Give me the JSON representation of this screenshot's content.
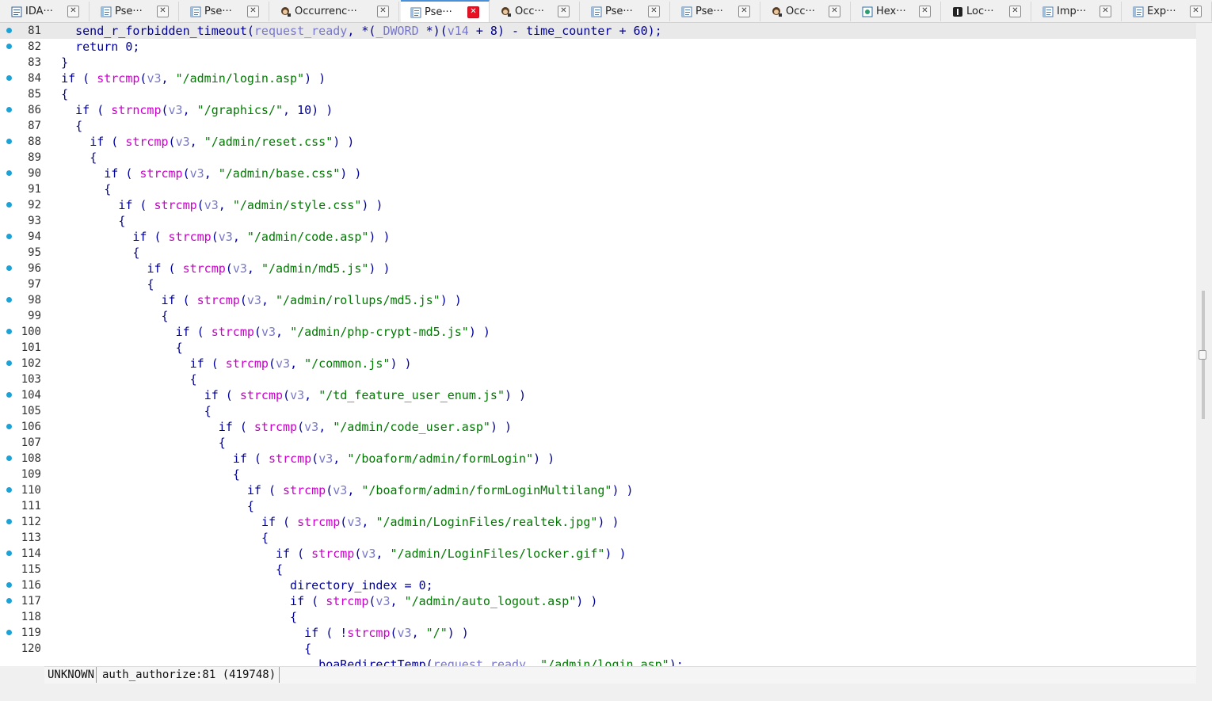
{
  "tabs": [
    {
      "label": "IDA···",
      "icon": "ida-view-icon"
    },
    {
      "label": "Pse···",
      "icon": "pseudocode-icon"
    },
    {
      "label": "Pse···",
      "icon": "pseudocode-icon"
    },
    {
      "label": "Occurrenc···",
      "icon": "occurrences-icon"
    },
    {
      "label": "Pse···",
      "icon": "pseudocode-icon",
      "active": true
    },
    {
      "label": "Occ···",
      "icon": "occurrences-icon"
    },
    {
      "label": "Pse···",
      "icon": "pseudocode-icon"
    },
    {
      "label": "Pse···",
      "icon": "pseudocode-icon"
    },
    {
      "label": "Occ···",
      "icon": "occurrences-icon"
    },
    {
      "label": "Hex···",
      "icon": "hex-view-icon"
    },
    {
      "label": "Loc···",
      "icon": "local-types-icon"
    },
    {
      "label": "Imp···",
      "icon": "imports-icon"
    },
    {
      "label": "Exp···",
      "icon": "exports-icon"
    }
  ],
  "close_glyph": "✕",
  "code_lines": [
    {
      "n": "81",
      "bp": true,
      "current": true,
      "indent": "    ",
      "tokens": [
        [
          "fn2",
          "send_r_forbidden_timeout"
        ],
        [
          "p",
          "("
        ],
        [
          "v",
          "request_ready"
        ],
        [
          "p",
          ", *("
        ],
        [
          "v",
          "_DWORD"
        ],
        [
          "p",
          " *)("
        ],
        [
          "v",
          "v14"
        ],
        [
          "p",
          " + 8) - "
        ],
        [
          "g",
          "time_counter"
        ],
        [
          "p",
          " + 60);"
        ]
      ]
    },
    {
      "n": "82",
      "bp": true,
      "indent": "    ",
      "tokens": [
        [
          "p",
          "return 0;"
        ]
      ]
    },
    {
      "n": "83",
      "bp": false,
      "indent": "  ",
      "tokens": [
        [
          "p",
          "}"
        ]
      ]
    },
    {
      "n": "84",
      "bp": true,
      "indent": "  ",
      "tokens": [
        [
          "p",
          "if ( "
        ],
        [
          "fn",
          "strcmp"
        ],
        [
          "p",
          "("
        ],
        [
          "v",
          "v3"
        ],
        [
          "p",
          ", "
        ],
        [
          "s",
          "\"/admin/login.asp\""
        ],
        [
          "p",
          ") )"
        ]
      ]
    },
    {
      "n": "85",
      "bp": false,
      "indent": "  ",
      "tokens": [
        [
          "p",
          "{"
        ]
      ]
    },
    {
      "n": "86",
      "bp": true,
      "indent": "    ",
      "tokens": [
        [
          "p",
          "if ( "
        ],
        [
          "fn",
          "strncmp"
        ],
        [
          "p",
          "("
        ],
        [
          "v",
          "v3"
        ],
        [
          "p",
          ", "
        ],
        [
          "s",
          "\"/graphics/\""
        ],
        [
          "p",
          ", 10) )"
        ]
      ]
    },
    {
      "n": "87",
      "bp": false,
      "indent": "    ",
      "tokens": [
        [
          "p",
          "{"
        ]
      ]
    },
    {
      "n": "88",
      "bp": true,
      "indent": "      ",
      "tokens": [
        [
          "p",
          "if ( "
        ],
        [
          "fn",
          "strcmp"
        ],
        [
          "p",
          "("
        ],
        [
          "v",
          "v3"
        ],
        [
          "p",
          ", "
        ],
        [
          "s",
          "\"/admin/reset.css\""
        ],
        [
          "p",
          ") )"
        ]
      ]
    },
    {
      "n": "89",
      "bp": false,
      "indent": "      ",
      "tokens": [
        [
          "p",
          "{"
        ]
      ]
    },
    {
      "n": "90",
      "bp": true,
      "indent": "        ",
      "tokens": [
        [
          "p",
          "if ( "
        ],
        [
          "fn",
          "strcmp"
        ],
        [
          "p",
          "("
        ],
        [
          "v",
          "v3"
        ],
        [
          "p",
          ", "
        ],
        [
          "s",
          "\"/admin/base.css\""
        ],
        [
          "p",
          ") )"
        ]
      ]
    },
    {
      "n": "91",
      "bp": false,
      "indent": "        ",
      "tokens": [
        [
          "p",
          "{"
        ]
      ]
    },
    {
      "n": "92",
      "bp": true,
      "indent": "          ",
      "tokens": [
        [
          "p",
          "if ( "
        ],
        [
          "fn",
          "strcmp"
        ],
        [
          "p",
          "("
        ],
        [
          "v",
          "v3"
        ],
        [
          "p",
          ", "
        ],
        [
          "s",
          "\"/admin/style.css\""
        ],
        [
          "p",
          ") )"
        ]
      ]
    },
    {
      "n": "93",
      "bp": false,
      "indent": "          ",
      "tokens": [
        [
          "p",
          "{"
        ]
      ]
    },
    {
      "n": "94",
      "bp": true,
      "indent": "            ",
      "tokens": [
        [
          "p",
          "if ( "
        ],
        [
          "fn",
          "strcmp"
        ],
        [
          "p",
          "("
        ],
        [
          "v",
          "v3"
        ],
        [
          "p",
          ", "
        ],
        [
          "s",
          "\"/admin/code.asp\""
        ],
        [
          "p",
          ") )"
        ]
      ]
    },
    {
      "n": "95",
      "bp": false,
      "indent": "            ",
      "tokens": [
        [
          "p",
          "{"
        ]
      ]
    },
    {
      "n": "96",
      "bp": true,
      "indent": "              ",
      "tokens": [
        [
          "p",
          "if ( "
        ],
        [
          "fn",
          "strcmp"
        ],
        [
          "p",
          "("
        ],
        [
          "v",
          "v3"
        ],
        [
          "p",
          ", "
        ],
        [
          "s",
          "\"/admin/md5.js\""
        ],
        [
          "p",
          ") )"
        ]
      ]
    },
    {
      "n": "97",
      "bp": false,
      "indent": "              ",
      "tokens": [
        [
          "p",
          "{"
        ]
      ]
    },
    {
      "n": "98",
      "bp": true,
      "indent": "                ",
      "tokens": [
        [
          "p",
          "if ( "
        ],
        [
          "fn",
          "strcmp"
        ],
        [
          "p",
          "("
        ],
        [
          "v",
          "v3"
        ],
        [
          "p",
          ", "
        ],
        [
          "s",
          "\"/admin/rollups/md5.js\""
        ],
        [
          "p",
          ") )"
        ]
      ]
    },
    {
      "n": "99",
      "bp": false,
      "indent": "                ",
      "tokens": [
        [
          "p",
          "{"
        ]
      ]
    },
    {
      "n": "100",
      "bp": true,
      "indent": "                  ",
      "tokens": [
        [
          "p",
          "if ( "
        ],
        [
          "fn",
          "strcmp"
        ],
        [
          "p",
          "("
        ],
        [
          "v",
          "v3"
        ],
        [
          "p",
          ", "
        ],
        [
          "s",
          "\"/admin/php-crypt-md5.js\""
        ],
        [
          "p",
          ") )"
        ]
      ]
    },
    {
      "n": "101",
      "bp": false,
      "indent": "                  ",
      "tokens": [
        [
          "p",
          "{"
        ]
      ]
    },
    {
      "n": "102",
      "bp": true,
      "indent": "                    ",
      "tokens": [
        [
          "p",
          "if ( "
        ],
        [
          "fn",
          "strcmp"
        ],
        [
          "p",
          "("
        ],
        [
          "v",
          "v3"
        ],
        [
          "p",
          ", "
        ],
        [
          "s",
          "\"/common.js\""
        ],
        [
          "p",
          ") )"
        ]
      ]
    },
    {
      "n": "103",
      "bp": false,
      "indent": "                    ",
      "tokens": [
        [
          "p",
          "{"
        ]
      ]
    },
    {
      "n": "104",
      "bp": true,
      "indent": "                      ",
      "tokens": [
        [
          "p",
          "if ( "
        ],
        [
          "fn",
          "strcmp"
        ],
        [
          "p",
          "("
        ],
        [
          "v",
          "v3"
        ],
        [
          "p",
          ", "
        ],
        [
          "s",
          "\"/td_feature_user_enum.js\""
        ],
        [
          "p",
          ") )"
        ]
      ]
    },
    {
      "n": "105",
      "bp": false,
      "indent": "                      ",
      "tokens": [
        [
          "p",
          "{"
        ]
      ]
    },
    {
      "n": "106",
      "bp": true,
      "indent": "                        ",
      "tokens": [
        [
          "p",
          "if ( "
        ],
        [
          "fn",
          "strcmp"
        ],
        [
          "p",
          "("
        ],
        [
          "v",
          "v3"
        ],
        [
          "p",
          ", "
        ],
        [
          "s",
          "\"/admin/code_user.asp\""
        ],
        [
          "p",
          ") )"
        ]
      ]
    },
    {
      "n": "107",
      "bp": false,
      "indent": "                        ",
      "tokens": [
        [
          "p",
          "{"
        ]
      ]
    },
    {
      "n": "108",
      "bp": true,
      "indent": "                          ",
      "tokens": [
        [
          "p",
          "if ( "
        ],
        [
          "fn",
          "strcmp"
        ],
        [
          "p",
          "("
        ],
        [
          "v",
          "v3"
        ],
        [
          "p",
          ", "
        ],
        [
          "s",
          "\"/boaform/admin/formLogin\""
        ],
        [
          "p",
          ") )"
        ]
      ]
    },
    {
      "n": "109",
      "bp": false,
      "indent": "                          ",
      "tokens": [
        [
          "p",
          "{"
        ]
      ]
    },
    {
      "n": "110",
      "bp": true,
      "indent": "                            ",
      "tokens": [
        [
          "p",
          "if ( "
        ],
        [
          "fn",
          "strcmp"
        ],
        [
          "p",
          "("
        ],
        [
          "v",
          "v3"
        ],
        [
          "p",
          ", "
        ],
        [
          "s",
          "\"/boaform/admin/formLoginMultilang\""
        ],
        [
          "p",
          ") )"
        ]
      ]
    },
    {
      "n": "111",
      "bp": false,
      "indent": "                            ",
      "tokens": [
        [
          "p",
          "{"
        ]
      ]
    },
    {
      "n": "112",
      "bp": true,
      "indent": "                              ",
      "tokens": [
        [
          "p",
          "if ( "
        ],
        [
          "fn",
          "strcmp"
        ],
        [
          "p",
          "("
        ],
        [
          "v",
          "v3"
        ],
        [
          "p",
          ", "
        ],
        [
          "s",
          "\"/admin/LoginFiles/realtek.jpg\""
        ],
        [
          "p",
          ") )"
        ]
      ]
    },
    {
      "n": "113",
      "bp": false,
      "indent": "                              ",
      "tokens": [
        [
          "p",
          "{"
        ]
      ]
    },
    {
      "n": "114",
      "bp": true,
      "indent": "                                ",
      "tokens": [
        [
          "p",
          "if ( "
        ],
        [
          "fn",
          "strcmp"
        ],
        [
          "p",
          "("
        ],
        [
          "v",
          "v3"
        ],
        [
          "p",
          ", "
        ],
        [
          "s",
          "\"/admin/LoginFiles/locker.gif\""
        ],
        [
          "p",
          ") )"
        ]
      ]
    },
    {
      "n": "115",
      "bp": false,
      "indent": "                                ",
      "tokens": [
        [
          "p",
          "{"
        ]
      ]
    },
    {
      "n": "116",
      "bp": true,
      "indent": "                                  ",
      "tokens": [
        [
          "g",
          "directory_index"
        ],
        [
          "p",
          " = 0;"
        ]
      ]
    },
    {
      "n": "117",
      "bp": true,
      "indent": "                                  ",
      "tokens": [
        [
          "p",
          "if ( "
        ],
        [
          "fn",
          "strcmp"
        ],
        [
          "p",
          "("
        ],
        [
          "v",
          "v3"
        ],
        [
          "p",
          ", "
        ],
        [
          "s",
          "\"/admin/auto_logout.asp\""
        ],
        [
          "p",
          ") )"
        ]
      ]
    },
    {
      "n": "118",
      "bp": false,
      "indent": "                                  ",
      "tokens": [
        [
          "p",
          "{"
        ]
      ]
    },
    {
      "n": "119",
      "bp": true,
      "indent": "                                    ",
      "tokens": [
        [
          "p",
          "if ( !"
        ],
        [
          "fn",
          "strcmp"
        ],
        [
          "p",
          "("
        ],
        [
          "v",
          "v3"
        ],
        [
          "p",
          ", "
        ],
        [
          "s",
          "\"/\""
        ],
        [
          "p",
          ") )"
        ]
      ]
    },
    {
      "n": "120",
      "bp": false,
      "indent": "                                    ",
      "tokens": [
        [
          "p",
          "{"
        ]
      ]
    },
    {
      "n": "",
      "bp": false,
      "indent": "                                      ",
      "tokens": [
        [
          "g",
          "boaRedirectTemp"
        ],
        [
          "p",
          "("
        ],
        [
          "v",
          "request_ready"
        ],
        [
          "p",
          ", "
        ],
        [
          "s",
          "\"/admin/login.asp\""
        ],
        [
          "p",
          ");"
        ]
      ]
    }
  ],
  "status": {
    "kind": "UNKNOWN",
    "location": "auth_authorize:81 (419748)"
  },
  "scroll": {
    "position_fraction": 0.52,
    "visible_fraction": 0.2
  },
  "colors": {
    "keyword": "#00009a",
    "function": "#cc00cc",
    "string": "#007a00",
    "variable": "#7777cc",
    "breakpoint": "#1aa3d9",
    "current_line": "#e9e9e9",
    "active_tab_close": "#e81123"
  }
}
